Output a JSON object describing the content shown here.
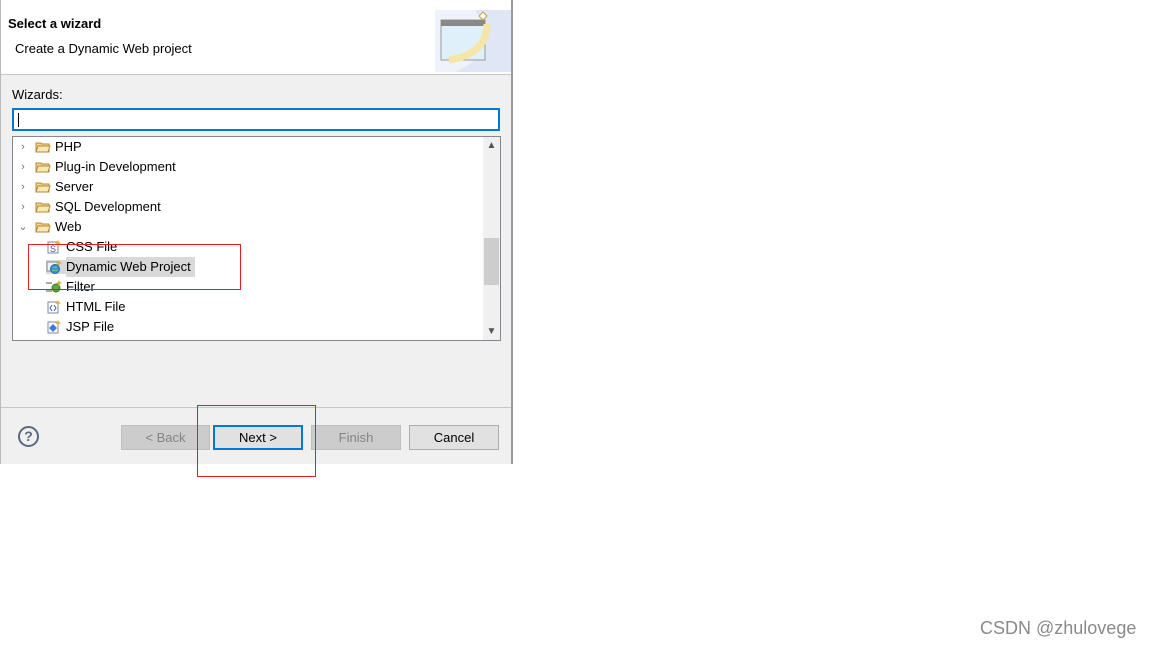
{
  "header": {
    "title": "Select a wizard",
    "subtitle": "Create a Dynamic Web project",
    "banner_icon": "wizard-banner-icon"
  },
  "wizards": {
    "label": "Wizards:",
    "filter_value": "",
    "items": [
      {
        "label": "PHP",
        "expanded": false,
        "level": 0,
        "icon": "folder-icon"
      },
      {
        "label": "Plug-in Development",
        "expanded": false,
        "level": 0,
        "icon": "folder-icon"
      },
      {
        "label": "Server",
        "expanded": false,
        "level": 0,
        "icon": "folder-icon"
      },
      {
        "label": "SQL Development",
        "expanded": false,
        "level": 0,
        "icon": "folder-icon"
      },
      {
        "label": "Web",
        "expanded": true,
        "level": 0,
        "icon": "folder-icon"
      },
      {
        "label": "CSS File",
        "level": 1,
        "icon": "css-file-icon"
      },
      {
        "label": "Dynamic Web Project",
        "level": 1,
        "icon": "web-project-icon",
        "selected": true
      },
      {
        "label": "Filter",
        "level": 1,
        "icon": "filter-icon"
      },
      {
        "label": "HTML File",
        "level": 1,
        "icon": "html-file-icon"
      },
      {
        "label": "JSP File",
        "level": 1,
        "icon": "jsp-file-icon"
      }
    ]
  },
  "buttons": {
    "back": "< Back",
    "next": "Next >",
    "finish": "Finish",
    "cancel": "Cancel",
    "help": "?"
  },
  "colors": {
    "accent": "#0078d7",
    "highlight": "#e02020",
    "selection": "#d9d9d9"
  },
  "watermark": "CSDN @zhulovege"
}
